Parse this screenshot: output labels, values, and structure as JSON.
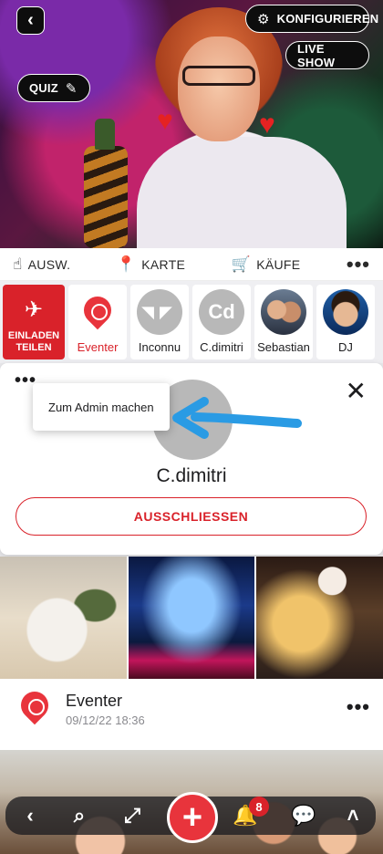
{
  "header": {
    "configure_label": "KONFIGURIEREN",
    "live_show_label": "LIVE SHOW",
    "quiz_label": "QUIZ"
  },
  "actions": {
    "items": [
      {
        "label": "AUSW.",
        "icon": "hand-pointer-icon"
      },
      {
        "label": "KARTE",
        "icon": "map-pin-icon"
      },
      {
        "label": "KÄUFE",
        "icon": "cart-icon"
      }
    ],
    "more_label": "•••"
  },
  "members": {
    "invite_label": "EINLADEN TEILEN",
    "list": [
      {
        "name": "Eventer",
        "type": "pin"
      },
      {
        "name": "Inconnu",
        "type": "alien"
      },
      {
        "name": "C.dimitri",
        "initials": "Cd"
      },
      {
        "name": "Sebastian",
        "type": "photo"
      },
      {
        "name": "DJ",
        "type": "photo"
      }
    ]
  },
  "admin_card": {
    "menu_item": "Zum Admin machen",
    "username": "C.dimitri",
    "exclude_label": "AUSSCHLIESSEN",
    "dots": "•••",
    "close": "✕"
  },
  "post": {
    "title": "Eventer",
    "date": "09/12/22 18:36",
    "more": "•••"
  },
  "navbar": {
    "notifications_count": "8"
  },
  "colors": {
    "accent_red": "#d9222a",
    "pin_red": "#e8343c",
    "arrow_blue": "#2a9be4"
  }
}
